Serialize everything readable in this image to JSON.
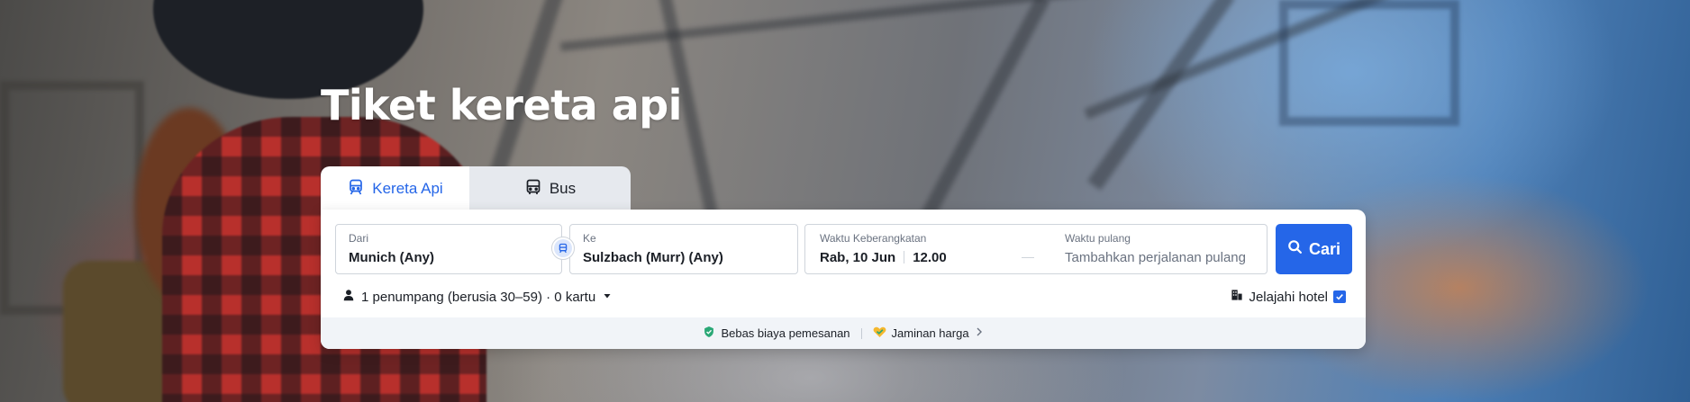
{
  "page": {
    "title": "Tiket kereta api"
  },
  "tabs": [
    {
      "label": "Kereta Api",
      "icon": "train-icon",
      "active": true
    },
    {
      "label": "Bus",
      "icon": "bus-icon",
      "active": false
    }
  ],
  "search": {
    "from": {
      "label": "Dari",
      "value": "Munich (Any)"
    },
    "to": {
      "label": "Ke",
      "value": "Sulzbach (Murr) (Any)"
    },
    "departure": {
      "label": "Waktu Keberangkatan",
      "date": "Rab, 10 Jun",
      "time": "12.00"
    },
    "return": {
      "label": "Waktu pulang",
      "placeholder": "Tambahkan perjalanan pulang"
    },
    "submit_label": "Cari"
  },
  "options": {
    "passengers": "1 penumpang (berusia 30–59) · 0 kartu",
    "hotel_label": "Jelajahi hotel",
    "hotel_checked": true
  },
  "footer": {
    "no_fee": "Bebas biaya pemesanan",
    "price_guarantee": "Jaminan harga"
  },
  "colors": {
    "accent": "#2566e8",
    "text": "#1b1f26",
    "muted": "#6a7280",
    "footer_bg": "#f1f4f8"
  }
}
